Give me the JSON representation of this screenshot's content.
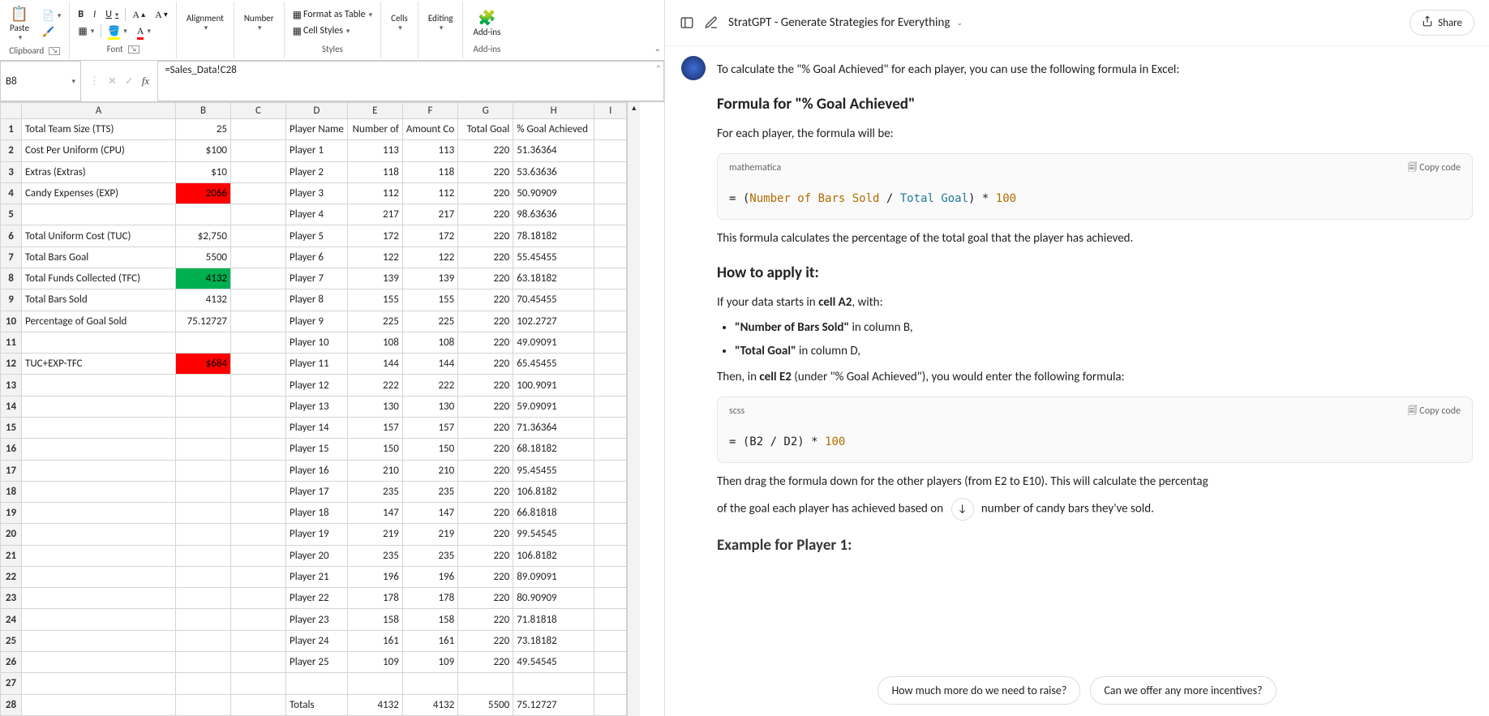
{
  "ribbon": {
    "paste": "Paste",
    "clipboard": "Clipboard",
    "font": "Font",
    "alignment": "Alignment",
    "number": "Number",
    "format_table": "Format as Table",
    "cell_styles": "Cell Styles",
    "styles": "Styles",
    "cells": "Cells",
    "editing": "Editing",
    "addins": "Add-ins",
    "addins2": "Add-ins"
  },
  "namebox": "B8",
  "formula": "=Sales_Data!C28",
  "columns": [
    "A",
    "B",
    "C",
    "D",
    "E",
    "F",
    "G",
    "H",
    "I"
  ],
  "colwidths": {
    "A": 190,
    "B": 68,
    "C": 68,
    "D": 68,
    "E": 68,
    "F": 68,
    "G": 68,
    "H": 100,
    "I": 40
  },
  "leftLabels": {
    "r1": "Total Team Size (TTS)",
    "r2": "Cost Per Uniform (CPU)",
    "r3": "Extras (Extras)",
    "r4": "Candy Expenses (EXP)",
    "r6": "Total Uniform Cost (TUC)",
    "r7": "Total Bars Goal",
    "r8": "Total Funds Collected (TFC)",
    "r9": "Total Bars Sold",
    "r10": "Percentage of Goal Sold",
    "r12": "TUC+EXP-TFC"
  },
  "leftValues": {
    "r1": "25",
    "r2": "$100",
    "r3": "$10",
    "r4": "2066",
    "r6": "$2,750",
    "r7": "5500",
    "r8": "4132",
    "r9": "4132",
    "r10": "75.12727",
    "r12": "$684"
  },
  "headerRow": {
    "D": "Player Name",
    "E": "Number of",
    "F": "Amount Co",
    "G": "Total Goal",
    "H": "% Goal Achieved"
  },
  "players": [
    {
      "name": "Player 1",
      "num": "113",
      "amt": "113",
      "goal": "220",
      "pct": "51.36364"
    },
    {
      "name": "Player 2",
      "num": "118",
      "amt": "118",
      "goal": "220",
      "pct": "53.63636"
    },
    {
      "name": "Player 3",
      "num": "112",
      "amt": "112",
      "goal": "220",
      "pct": "50.90909"
    },
    {
      "name": "Player 4",
      "num": "217",
      "amt": "217",
      "goal": "220",
      "pct": "98.63636"
    },
    {
      "name": "Player 5",
      "num": "172",
      "amt": "172",
      "goal": "220",
      "pct": "78.18182"
    },
    {
      "name": "Player 6",
      "num": "122",
      "amt": "122",
      "goal": "220",
      "pct": "55.45455"
    },
    {
      "name": "Player 7",
      "num": "139",
      "amt": "139",
      "goal": "220",
      "pct": "63.18182"
    },
    {
      "name": "Player 8",
      "num": "155",
      "amt": "155",
      "goal": "220",
      "pct": "70.45455"
    },
    {
      "name": "Player 9",
      "num": "225",
      "amt": "225",
      "goal": "220",
      "pct": "102.2727"
    },
    {
      "name": "Player 10",
      "num": "108",
      "amt": "108",
      "goal": "220",
      "pct": "49.09091"
    },
    {
      "name": "Player 11",
      "num": "144",
      "amt": "144",
      "goal": "220",
      "pct": "65.45455"
    },
    {
      "name": "Player 12",
      "num": "222",
      "amt": "222",
      "goal": "220",
      "pct": "100.9091"
    },
    {
      "name": "Player 13",
      "num": "130",
      "amt": "130",
      "goal": "220",
      "pct": "59.09091"
    },
    {
      "name": "Player 14",
      "num": "157",
      "amt": "157",
      "goal": "220",
      "pct": "71.36364"
    },
    {
      "name": "Player 15",
      "num": "150",
      "amt": "150",
      "goal": "220",
      "pct": "68.18182"
    },
    {
      "name": "Player 16",
      "num": "210",
      "amt": "210",
      "goal": "220",
      "pct": "95.45455"
    },
    {
      "name": "Player 17",
      "num": "235",
      "amt": "235",
      "goal": "220",
      "pct": "106.8182"
    },
    {
      "name": "Player 18",
      "num": "147",
      "amt": "147",
      "goal": "220",
      "pct": "66.81818"
    },
    {
      "name": "Player 19",
      "num": "219",
      "amt": "219",
      "goal": "220",
      "pct": "99.54545"
    },
    {
      "name": "Player 20",
      "num": "235",
      "amt": "235",
      "goal": "220",
      "pct": "106.8182"
    },
    {
      "name": "Player 21",
      "num": "196",
      "amt": "196",
      "goal": "220",
      "pct": "89.09091"
    },
    {
      "name": "Player 22",
      "num": "178",
      "amt": "178",
      "goal": "220",
      "pct": "80.90909"
    },
    {
      "name": "Player 23",
      "num": "158",
      "amt": "158",
      "goal": "220",
      "pct": "71.81818"
    },
    {
      "name": "Player 24",
      "num": "161",
      "amt": "161",
      "goal": "220",
      "pct": "73.18182"
    },
    {
      "name": "Player 25",
      "num": "109",
      "amt": "109",
      "goal": "220",
      "pct": "49.54545"
    }
  ],
  "totalsRow": {
    "label": "Totals",
    "num": "4132",
    "amt": "4132",
    "goal": "5500",
    "pct": "75.12727"
  },
  "chat": {
    "title": "StratGPT - Generate Strategies for Everything",
    "share": "Share",
    "intro": "To calculate the \"% Goal Achieved\" for each player, you can use the following formula in Excel:",
    "h_formula": "Formula for \"% Goal Achieved\"",
    "p_each": "For each player, the formula will be:",
    "code1_lang": "mathematica",
    "copy": "Copy code",
    "code1_eq": "= (",
    "code1_a": "Number of Bars Sold",
    "code1_slash": " / ",
    "code1_b": "Total Goal",
    "code1_rest": ") * ",
    "code1_num": "100",
    "p_explain": "This formula calculates the percentage of the total goal that the player has achieved.",
    "h_apply": "How to apply it:",
    "p_apply1a": "If your data starts in ",
    "p_apply1b": "cell A2",
    "p_apply1c": ", with:",
    "li1a": "\"Number of Bars Sold\"",
    "li1b": " in column B,",
    "li2a": "\"Total Goal\"",
    "li2b": " in column D,",
    "p_then_a": "Then, in ",
    "p_then_b": "cell E2",
    "p_then_c": " (under \"% Goal Achieved\"), you would enter the following formula:",
    "code2_lang": "scss",
    "code2_body_a": "= (B2 / D2) * ",
    "code2_num": "100",
    "p_drag": "Then drag the formula down for the other players (from E2 to E10). This will calculate the percentag",
    "p_drag2a": "of the goal each player has achieved based on",
    "p_drag2b": "number of candy bars they've sold.",
    "h_example": "Example for Player 1:",
    "sug1": "How much more do we need to raise?",
    "sug2": "Can we offer any more incentives?"
  }
}
